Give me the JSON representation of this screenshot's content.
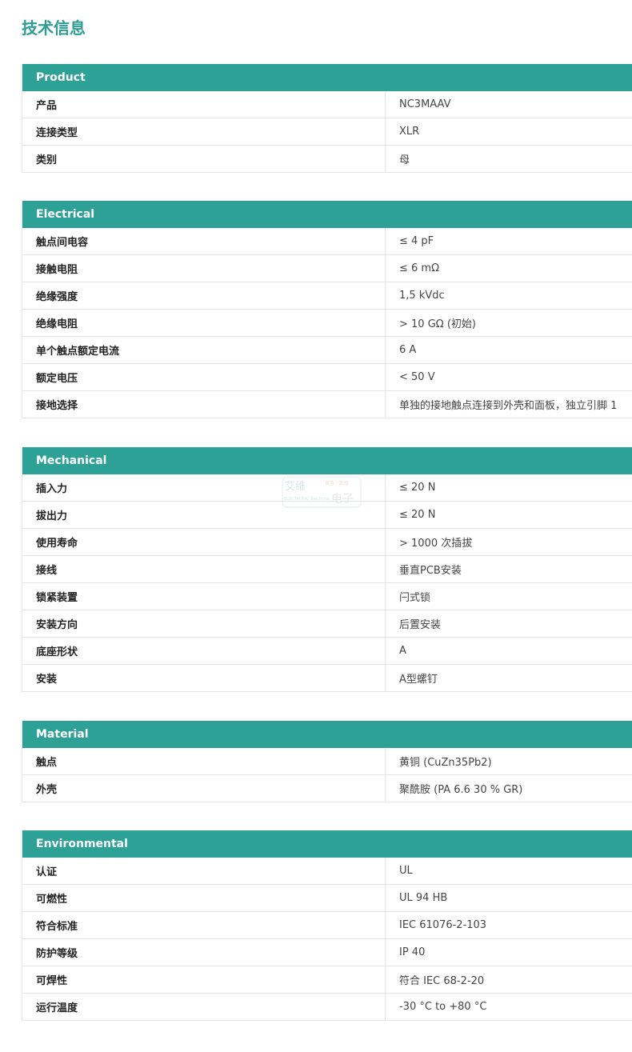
{
  "page_title": "技术信息",
  "sections": [
    {
      "title": "Product",
      "rows": [
        {
          "label": "产品",
          "value": "NC3MAAV"
        },
        {
          "label": "连接类型",
          "value": "XLR"
        },
        {
          "label": "类别",
          "value": "母"
        }
      ]
    },
    {
      "title": "Electrical",
      "rows": [
        {
          "label": "触点间电容",
          "value": "≤ 4 pF"
        },
        {
          "label": "接触电阻",
          "value": "≤ 6 mΩ"
        },
        {
          "label": "绝缘强度",
          "value": "1,5 kVdc"
        },
        {
          "label": "绝缘电阻",
          "value": "> 10 GΩ (初始)"
        },
        {
          "label": "单个触点额定电流",
          "value": "6 A"
        },
        {
          "label": "额定电压",
          "value": "< 50 V"
        },
        {
          "label": "接地选择",
          "value": "单独的接地触点连接到外壳和面板，独立引脚 1"
        }
      ]
    },
    {
      "title": "Mechanical",
      "rows": [
        {
          "label": "插入力",
          "value": "≤ 20 N"
        },
        {
          "label": "拔出力",
          "value": "≤ 20 N"
        },
        {
          "label": "使用寿命",
          "value": "> 1000 次插拔"
        },
        {
          "label": "接线",
          "value": "垂直PCB安装"
        },
        {
          "label": "锁紧装置",
          "value": "闩式锁"
        },
        {
          "label": "安装方向",
          "value": "后置安装"
        },
        {
          "label": "底座形状",
          "value": "A"
        },
        {
          "label": "安装",
          "value": "A型螺钉"
        }
      ]
    },
    {
      "title": "Material",
      "rows": [
        {
          "label": "触点",
          "value": "黄铜 (CuZn35Pb2)"
        },
        {
          "label": "外壳",
          "value": "聚酰胺 (PA 6.6 30 % GR)"
        }
      ]
    },
    {
      "title": "Environmental",
      "rows": [
        {
          "label": "认证",
          "value": "UL"
        },
        {
          "label": "可燃性",
          "value": "UL 94 HB"
        },
        {
          "label": "符合标准",
          "value": "IEC 61076-2-103"
        },
        {
          "label": "防护等级",
          "value": "IP 40"
        },
        {
          "label": "可焊性",
          "value": "符合 IEC 68-2-20"
        },
        {
          "label": "运行温度",
          "value": "-30 °C to +80 °C"
        }
      ]
    }
  ],
  "watermark": {
    "brand_cn": "艾维",
    "brand_cn_2": "电子",
    "tag": "官方 · 正品",
    "brand_en": "ELECTRONIC Electronic"
  },
  "colors": {
    "accent": "#2ea197",
    "title": "#2e9e94",
    "border": "#e6e6e6"
  }
}
